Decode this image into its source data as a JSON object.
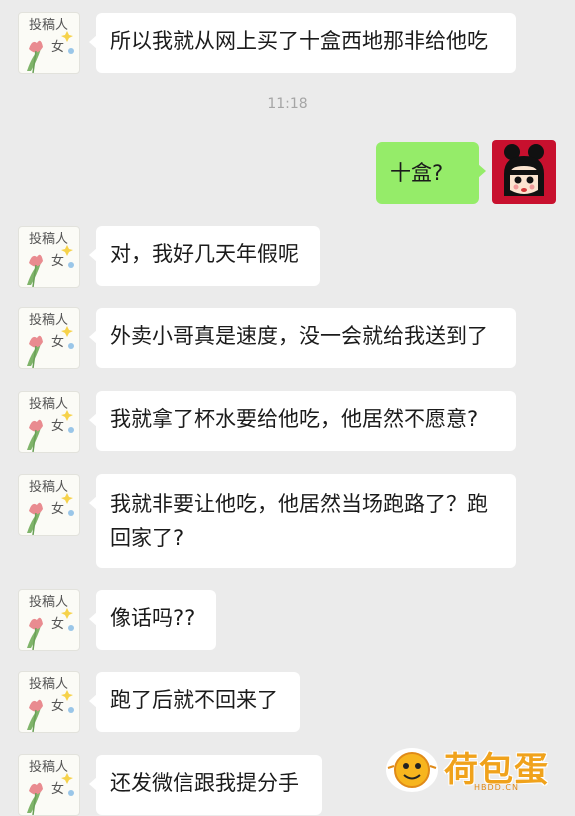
{
  "timestamp": "11:18",
  "avatar_text": {
    "line1": "投稿人",
    "line2": "女"
  },
  "self_message": "十盒?",
  "messages": [
    "所以我就从网上买了十盒西地那非给他吃",
    "对，我好几天年假呢",
    "外卖小哥真是速度，没一会就给我送到了",
    "我就拿了杯水要给他吃，他居然不愿意?",
    "我就非要让他吃，他居然当场跑路了？跑回家了?",
    "像话吗??",
    "跑了后就不回来了",
    "还发微信跟我提分手"
  ],
  "watermark": {
    "brand": "荷包蛋",
    "domain": "HBDD.CN"
  },
  "colors": {
    "background": "#ebebeb",
    "self_bubble": "#95ec69",
    "other_bubble": "#ffffff",
    "self_avatar_bg": "#c8102e"
  }
}
